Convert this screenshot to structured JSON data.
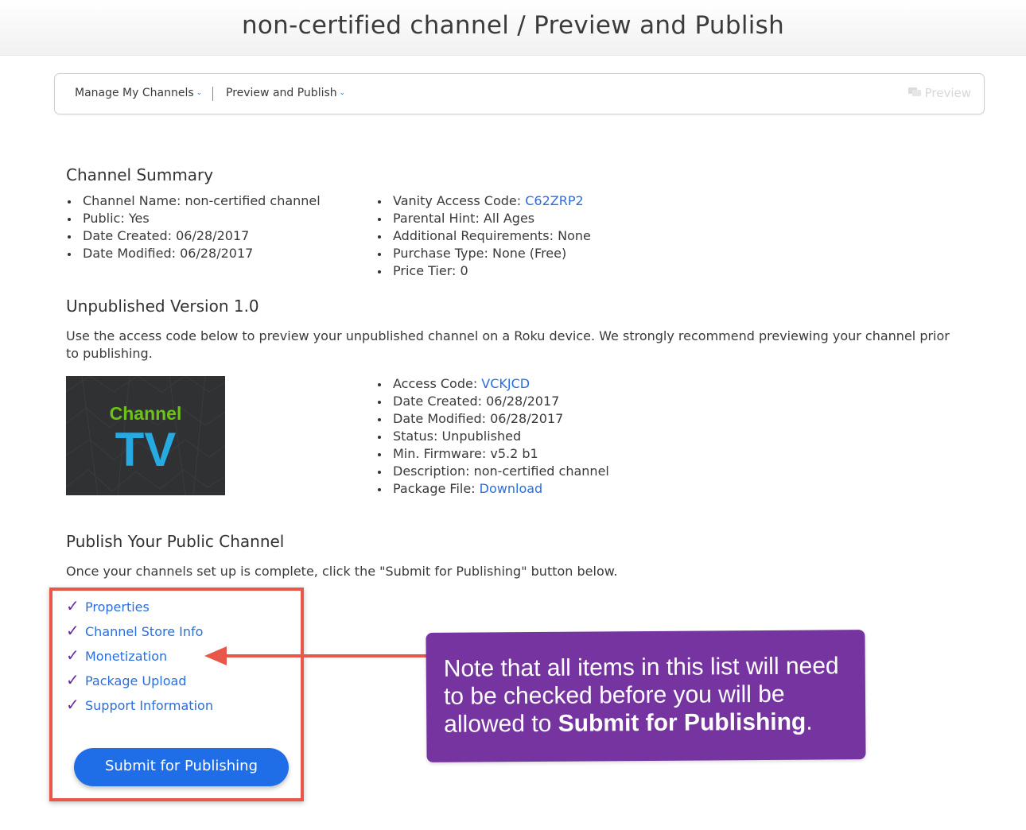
{
  "header": {
    "title": "non-certified channel / Preview and Publish"
  },
  "nav": {
    "manage_label": "Manage My Channels",
    "preview_publish_label": "Preview and Publish",
    "preview_button_label": "Preview"
  },
  "summary": {
    "title": "Channel Summary",
    "left_items": [
      "Channel Name: non-certified channel",
      "Public: Yes",
      "Date Created: 06/28/2017",
      "Date Modified: 06/28/2017"
    ],
    "right_items": {
      "vanity_label": "Vanity Access Code: ",
      "vanity_code": "C62ZRP2",
      "parental_hint": "Parental Hint: All Ages",
      "additional_requirements": "Additional Requirements: None",
      "purchase_type": "Purchase Type: None (Free)",
      "price_tier": "Price Tier: 0"
    }
  },
  "unpublished": {
    "title": "Unpublished Version 1.0",
    "description": "Use the access code below to preview your unpublished channel on a Roku device. We strongly recommend previewing your channel prior to publishing.",
    "thumbnail": {
      "line1": "Channel",
      "line2": "TV"
    },
    "access_label": "Access Code: ",
    "access_code": "VCKJCD",
    "date_created": "Date Created: 06/28/2017",
    "date_modified": "Date Modified: 06/28/2017",
    "status": "Status: Unpublished",
    "min_firmware": "Min. Firmware: v5.2 b1",
    "description_item": "Description: non-certified channel",
    "package_label": "Package File: ",
    "package_link": "Download"
  },
  "publish": {
    "title": "Publish Your Public Channel",
    "instructions": "Once your channels set up is complete, click the \"Submit for Publishing\" button below.",
    "checklist": [
      "Properties",
      "Channel Store Info",
      "Monetization",
      "Package Upload",
      "Support Information"
    ],
    "submit_label": "Submit for Publishing"
  },
  "callout": {
    "text_before": "Note that all items in this list will need to be checked before you will be allowed to ",
    "text_bold": "Submit for Publishing",
    "text_after": "."
  },
  "colors": {
    "link": "#2a6ede",
    "check": "#6a2aa3",
    "callout_bg": "#7634a0",
    "highlight_border": "#e8574a",
    "submit_bg": "#1f6ee8"
  }
}
